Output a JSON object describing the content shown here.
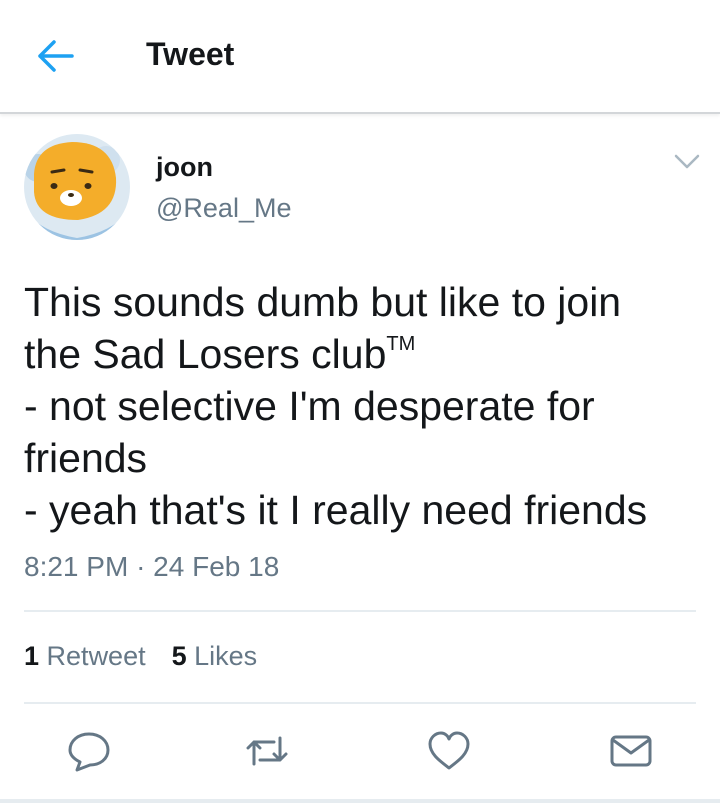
{
  "header": {
    "back_icon": "arrow-left-icon",
    "title": "Tweet",
    "accent_color": "#1da1f2"
  },
  "tweet": {
    "author": {
      "name": "joon",
      "handle": "@Real_Me",
      "avatar": "yellow-bear-character-avatar"
    },
    "menu_icon": "chevron-down-icon",
    "text_lines": [
      "This sounds dumb but like to join",
      "the Sad Losers club",
      "- not selective I'm desperate for",
      "friends",
      "- yeah that's it I really need friends"
    ],
    "trademark": "TM",
    "time": "8:21 PM",
    "separator": "·",
    "date": "24 Feb 18",
    "stats": {
      "retweets_count": "1",
      "retweets_label": "Retweet",
      "likes_count": "5",
      "likes_label": "Likes"
    },
    "actions": [
      "reply-icon",
      "retweet-icon",
      "like-icon",
      "message-icon"
    ]
  }
}
